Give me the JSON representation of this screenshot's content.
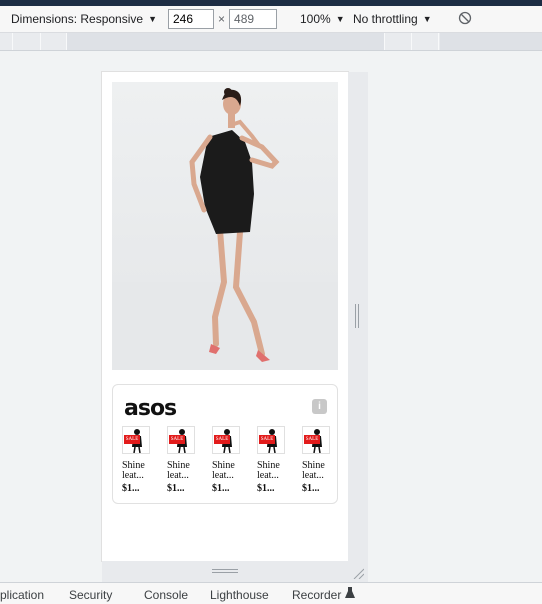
{
  "toolbar": {
    "dimensions_label": "Dimensions: Responsive",
    "width_value": "246",
    "times": "×",
    "height_value": "489",
    "zoom": "100%",
    "throttling": "No throttling",
    "rotate_icon": "rotate-icon"
  },
  "ad": {
    "brand": "asos",
    "info_label": "i",
    "products": [
      {
        "badge": "SALE",
        "name": "Shine leat...",
        "price": "$1..."
      },
      {
        "badge": "SALE",
        "name": "Shine leat...",
        "price": "$1..."
      },
      {
        "badge": "SALE",
        "name": "Shine leat...",
        "price": "$1..."
      },
      {
        "badge": "SALE",
        "name": "Shine leat...",
        "price": "$1..."
      },
      {
        "badge": "SALE",
        "name": "Shine leat...",
        "price": "$1..."
      }
    ]
  },
  "devtools_tabs": [
    "plication",
    "Security",
    "Console",
    "Lighthouse",
    "Recorder"
  ]
}
